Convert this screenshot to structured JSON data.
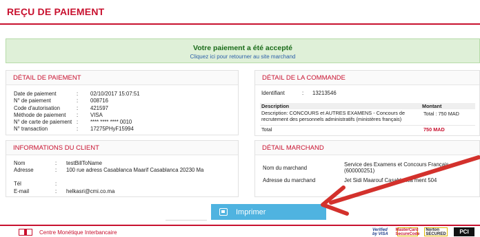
{
  "header": {
    "title": "REÇU DE PAIEMENT"
  },
  "notice": {
    "title": "Votre paiement a été accepté",
    "link": "Cliquez ici pour retourner au site marchand"
  },
  "payment": {
    "heading": "DÉTAIL DE PAIEMENT",
    "rows": [
      {
        "label": "Date de paiement",
        "sep": ":",
        "value": "02/10/2017 15:07:51"
      },
      {
        "label": "N° de paiement",
        "sep": ":",
        "value": "008716"
      },
      {
        "label": "Code d'autorisation",
        "sep": ":",
        "value": "421597"
      },
      {
        "label": "Méthode de paiement",
        "sep": ":",
        "value": "VISA"
      },
      {
        "label": "N° de carte de paiement",
        "sep": ":",
        "value": "**** **** **** 0010"
      },
      {
        "label": "N° transaction",
        "sep": ":",
        "value": "17275PHyF15994"
      }
    ]
  },
  "client": {
    "heading": "INFORMATIONS DU CLIENT",
    "rows": [
      {
        "label": "Nom",
        "sep": ":",
        "value": "testBillToName"
      },
      {
        "label": "Adresse",
        "sep": ":",
        "value": "100 rue adress Casablanca Maarif Casablanca 20230 Ma"
      },
      {
        "label": "Tél",
        "sep": ":",
        "value": ""
      },
      {
        "label": "E-mail",
        "sep": ":",
        "value": "helkasri@cmi.co.ma"
      }
    ]
  },
  "order": {
    "heading": "DÉTAIL DE LA COMMANDE",
    "id_label": "Identifiant",
    "id_sep": ":",
    "id_value": "13213546",
    "col_description": "Description",
    "col_amount": "Montant",
    "line_description": "Description: CONCOURS et AUTRES EXAMENS - Concours de recrutement des personnels administratifs (ministères français)",
    "line_amount": "Total : 750  MAD",
    "total_label": "Total",
    "total_value": "750 MAD"
  },
  "merchant": {
    "heading": "DÉTAIL MARCHAND",
    "rows": [
      {
        "label": "Nom du marchand",
        "value": "Service des Examens et Concours Français (600000251)"
      },
      {
        "label": "Adresse du marchand",
        "value": "Jet Sidi Maarouf Casablanca      ment 504"
      }
    ]
  },
  "actions": {
    "print_label": "Imprimer"
  },
  "footer": {
    "org": "Centre Monétique Interbancaire",
    "brands": [
      "Verified by VISA",
      "MasterCard SecureCode",
      "Norton SECURED",
      "PCI"
    ]
  },
  "colors": {
    "accent": "#c8102e",
    "success_bg": "#dff0d8",
    "button": "#4fb3e0",
    "arrow": "#d3312c"
  }
}
